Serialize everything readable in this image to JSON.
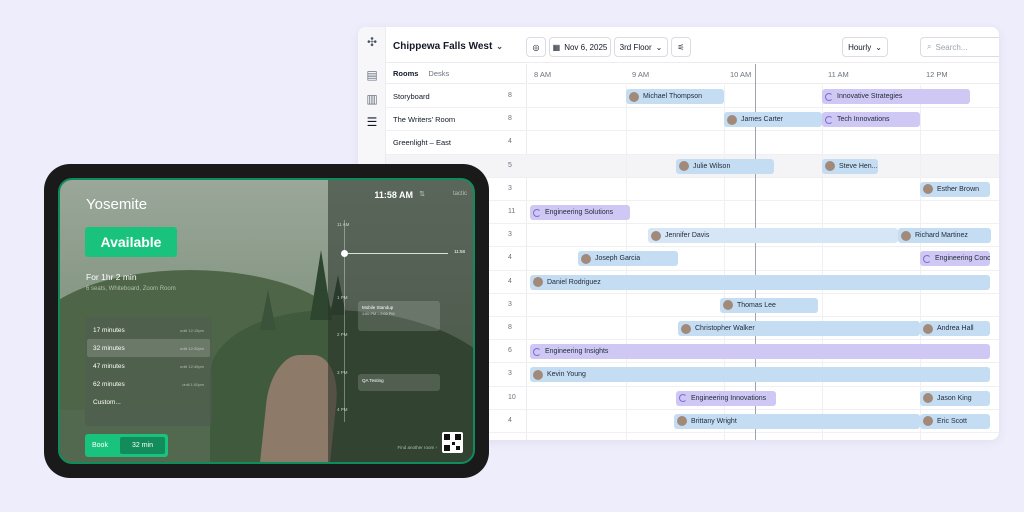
{
  "scheduler": {
    "location": "Chippewa Falls West",
    "date": "Nov 6, 2025",
    "floor": "3rd Floor",
    "view": "Hourly",
    "search_placeholder": "Search...",
    "tabs": [
      "Rooms",
      "Desks"
    ],
    "hours": [
      "8 AM",
      "9 AM",
      "10 AM",
      "11 AM",
      "12 PM"
    ],
    "rooms": [
      {
        "name": "Storyboard",
        "capacity": "8"
      },
      {
        "name": "The Writers' Room",
        "capacity": "8"
      },
      {
        "name": "Greenlight – East",
        "capacity": "4"
      },
      {
        "name": "",
        "capacity": "5"
      },
      {
        "name": "",
        "capacity": "3"
      },
      {
        "name": "",
        "capacity": "11"
      },
      {
        "name": "",
        "capacity": "3"
      },
      {
        "name": "",
        "capacity": "4"
      },
      {
        "name": "",
        "capacity": "4"
      },
      {
        "name": "",
        "capacity": "3"
      },
      {
        "name": "",
        "capacity": "8"
      },
      {
        "name": "",
        "capacity": "6"
      },
      {
        "name": "",
        "capacity": "3"
      },
      {
        "name": "",
        "capacity": "10"
      },
      {
        "name": "",
        "capacity": "4"
      }
    ],
    "events": [
      {
        "row": 0,
        "label": "Michael Thompson",
        "kind": "person",
        "color": "blue"
      },
      {
        "row": 0,
        "label": "Innovative Strategies",
        "kind": "group",
        "color": "purple"
      },
      {
        "row": 1,
        "label": "James Carter",
        "kind": "person",
        "color": "blue"
      },
      {
        "row": 1,
        "label": "Tech Innovations",
        "kind": "group",
        "color": "purple"
      },
      {
        "row": 3,
        "label": "Julie Wilson",
        "kind": "person",
        "color": "blue"
      },
      {
        "row": 3,
        "label": "Steve Hen...",
        "kind": "person",
        "color": "blue"
      },
      {
        "row": 4,
        "label": "Esther Brown",
        "kind": "person",
        "color": "blue"
      },
      {
        "row": 5,
        "label": "Engineering Solutions",
        "kind": "group",
        "color": "purple"
      },
      {
        "row": 6,
        "label": "Jennifer Davis",
        "kind": "person",
        "color": "lightblue"
      },
      {
        "row": 6,
        "label": "Richard Martinez",
        "kind": "person",
        "color": "blue"
      },
      {
        "row": 7,
        "label": "Joseph Garcia",
        "kind": "person",
        "color": "blue"
      },
      {
        "row": 7,
        "label": "Engineering Conce",
        "kind": "group",
        "color": "purple"
      },
      {
        "row": 8,
        "label": "Daniel Rodriguez",
        "kind": "person",
        "color": "blue"
      },
      {
        "row": 9,
        "label": "Thomas Lee",
        "kind": "person",
        "color": "blue"
      },
      {
        "row": 10,
        "label": "Christopher Walker",
        "kind": "person",
        "color": "blue"
      },
      {
        "row": 10,
        "label": "Andrea Hall",
        "kind": "person",
        "color": "blue"
      },
      {
        "row": 11,
        "label": "Engineering Insights",
        "kind": "group",
        "color": "purple"
      },
      {
        "row": 12,
        "label": "Kevin Young",
        "kind": "person",
        "color": "blue"
      },
      {
        "row": 13,
        "label": "Engineering Innovations",
        "kind": "group",
        "color": "purple"
      },
      {
        "row": 13,
        "label": "Jason King",
        "kind": "person",
        "color": "blue"
      },
      {
        "row": 14,
        "label": "Brittany Wright",
        "kind": "person",
        "color": "blue"
      },
      {
        "row": 14,
        "label": "Eric Scott",
        "kind": "person",
        "color": "blue"
      }
    ]
  },
  "tablet": {
    "room": "Yosemite",
    "status": "Available",
    "duration_text": "For 1hr 2 min",
    "amenities": "6 seats, Whiteboard, Zoom Room",
    "clock": "11:58 AM",
    "brand": "tactic",
    "now_time": "11:58",
    "durations": [
      {
        "label": "17 minutes",
        "until": "until 12:15pm"
      },
      {
        "label": "32 minutes",
        "until": "until 12:30pm"
      },
      {
        "label": "47 minutes",
        "until": "until 12:45pm"
      },
      {
        "label": "62 minutes",
        "until": "until 1:00pm"
      },
      {
        "label": "Custom...",
        "until": ""
      }
    ],
    "book_label": "Book",
    "book_duration": "32 min",
    "timeline_hours": [
      "11 AM",
      "1 PM",
      "2 PM",
      "3 PM",
      "4 PM"
    ],
    "timeline_events": [
      {
        "title": "Mobile Standup",
        "time": "1:00 PM – 2:00 PM"
      },
      {
        "title": "QA Testing",
        "time": "3:00 PM – 3:30 PM"
      }
    ],
    "find_text": "Find another room ›"
  },
  "colors": {
    "accent_green": "#19c37d",
    "event_blue": "#c5ddf3",
    "event_purple": "#cfc8f4"
  }
}
